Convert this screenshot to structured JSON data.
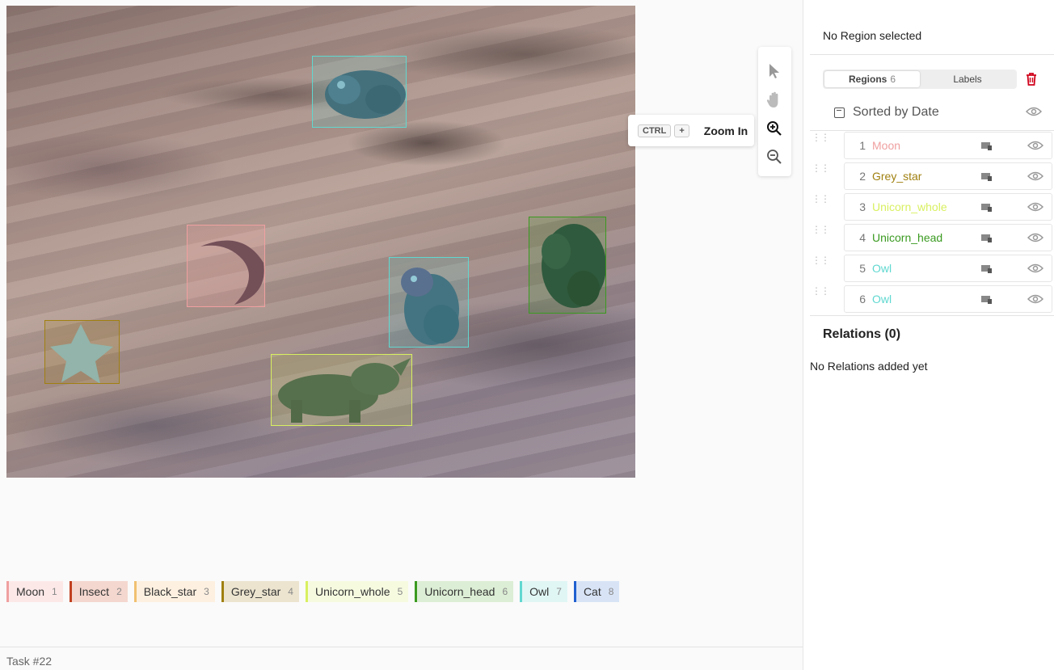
{
  "toolbar": {
    "tools": [
      {
        "icon": "cursor-icon",
        "active": false
      },
      {
        "icon": "hand-icon",
        "active": false
      },
      {
        "icon": "zoom-in-icon",
        "active": true
      },
      {
        "icon": "zoom-out-icon",
        "active": false
      }
    ],
    "tooltip": {
      "key1": "CTRL",
      "key2": "+",
      "label": "Zoom In"
    }
  },
  "labels": [
    {
      "name": "Moon",
      "hotkey": "1",
      "color": "#f0a0a0",
      "bg": "#fde8e8"
    },
    {
      "name": "Insect",
      "hotkey": "2",
      "color": "#c0401f",
      "bg": "#f4d7cf"
    },
    {
      "name": "Black_star",
      "hotkey": "3",
      "color": "#f0c070",
      "bg": "#fdf0e0"
    },
    {
      "name": "Grey_star",
      "hotkey": "4",
      "color": "#a08010",
      "bg": "#ece4cf"
    },
    {
      "name": "Unicorn_whole",
      "hotkey": "5",
      "color": "#d8f060",
      "bg": "#f6fbe0"
    },
    {
      "name": "Unicorn_head",
      "hotkey": "6",
      "color": "#3a9a20",
      "bg": "#dceed5"
    },
    {
      "name": "Owl",
      "hotkey": "7",
      "color": "#60d8d0",
      "bg": "#e0f6f5"
    },
    {
      "name": "Cat",
      "hotkey": "8",
      "color": "#2060d0",
      "bg": "#d8e4f6"
    }
  ],
  "footer": {
    "task": "Task #22"
  },
  "sidebar": {
    "no_region": "No Region selected",
    "tabs": [
      {
        "label": "Regions",
        "count": "6",
        "active": true
      },
      {
        "label": "Labels",
        "count": "",
        "active": false
      }
    ],
    "sorted_by": "Sorted by Date",
    "regions": [
      {
        "index": "1",
        "name": "Moon",
        "color": "#f0a0a0"
      },
      {
        "index": "2",
        "name": "Grey_star",
        "color": "#a08010"
      },
      {
        "index": "3",
        "name": "Unicorn_whole",
        "color": "#d8f060"
      },
      {
        "index": "4",
        "name": "Unicorn_head",
        "color": "#3a9a20"
      },
      {
        "index": "5",
        "name": "Owl",
        "color": "#60d8d0"
      },
      {
        "index": "6",
        "name": "Owl",
        "color": "#60d8d0"
      }
    ],
    "relations_title": "Relations (0)",
    "relations_empty": "No Relations added yet"
  }
}
